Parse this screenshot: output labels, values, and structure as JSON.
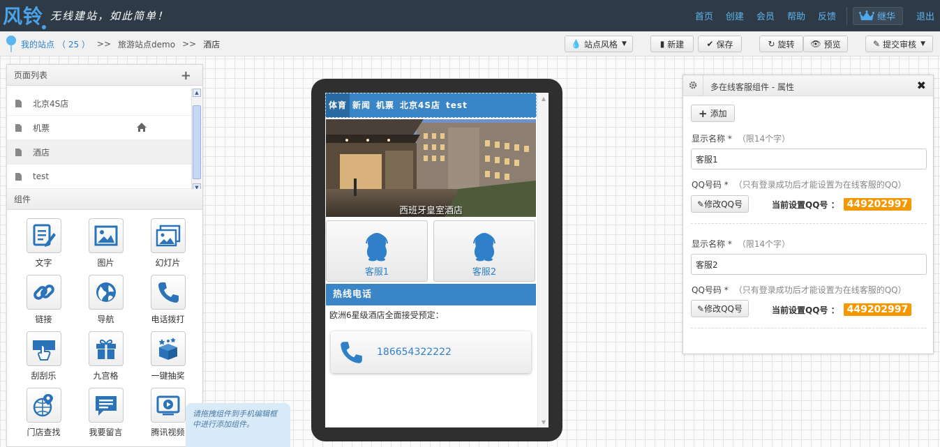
{
  "header": {
    "logo_text": "风铃",
    "slogan": "无线建站，如此简单！",
    "nav": [
      "首页",
      "创建",
      "会员",
      "帮助",
      "反馈"
    ],
    "user_name": "继华",
    "logout": "退出"
  },
  "breadcrumb": {
    "my_sites": "我的站点",
    "count": "（ 25 ）",
    "sep": ">>",
    "site": "旅游站点demo",
    "current": "酒店"
  },
  "toolbar": {
    "style": "站点风格",
    "new": "新建",
    "save": "保存",
    "rotate": "旋转",
    "preview": "预览",
    "submit": "提交审核"
  },
  "left_panel": {
    "pages_title": "页面列表",
    "pages": [
      {
        "label": "北京4S店"
      },
      {
        "label": "机票"
      },
      {
        "label": "酒店"
      },
      {
        "label": "test"
      }
    ],
    "components_title": "组件",
    "components": [
      {
        "label": "文字",
        "icon": "text-edit-icon"
      },
      {
        "label": "图片",
        "icon": "image-icon"
      },
      {
        "label": "幻灯片",
        "icon": "slideshow-icon"
      },
      {
        "label": "链接",
        "icon": "link-icon"
      },
      {
        "label": "导航",
        "icon": "globe-icon"
      },
      {
        "label": "电话拨打",
        "icon": "phone-icon"
      },
      {
        "label": "刮刮乐",
        "icon": "scratch-card-icon"
      },
      {
        "label": "九宫格",
        "icon": "gift-grid-icon"
      },
      {
        "label": "一键抽奖",
        "icon": "lottery-box-icon"
      },
      {
        "label": "门店查找",
        "icon": "store-locator-icon"
      },
      {
        "label": "我要留言",
        "icon": "message-icon"
      },
      {
        "label": "腾讯视频",
        "icon": "video-icon"
      }
    ],
    "hint": "请拖拽组件到手机编辑框中进行添加组件。"
  },
  "phone": {
    "nav": [
      "体育",
      "新闻",
      "机票",
      "北京4S店",
      "test"
    ],
    "hero_caption": "西班牙皇室酒店",
    "services": [
      "客服1",
      "客服2"
    ],
    "hotline_title": "热线电话",
    "hotline_text": "欧洲6星级酒店全面接受预定：",
    "phone_number": "186654322222"
  },
  "properties": {
    "title": "多在线客服组件 - 属性",
    "add": "添加",
    "entries": [
      {
        "name_label": "显示名称 *",
        "name_hint": "（限14个字）",
        "name_value": "客服1",
        "qq_label": "QQ号码 *",
        "qq_hint": "（只有登录成功后才能设置为在线客服的QQ）",
        "edit_label": "修改QQ号",
        "current_label": "当前设置QQ号 ：",
        "qq_value": "449202997"
      },
      {
        "name_label": "显示名称 *",
        "name_hint": "（限14个字）",
        "name_value": "客服2",
        "qq_label": "QQ号码 *",
        "qq_hint": "（只有登录成功后才能设置为在线客服的QQ）",
        "edit_label": "修改QQ号",
        "current_label": "当前设置QQ号 ：",
        "qq_value": "449202997"
      }
    ]
  },
  "colors": {
    "topbar": "#2e3a46",
    "accent": "#3a85c6",
    "link": "#2f80c8",
    "qq_badge": "#f39800"
  }
}
